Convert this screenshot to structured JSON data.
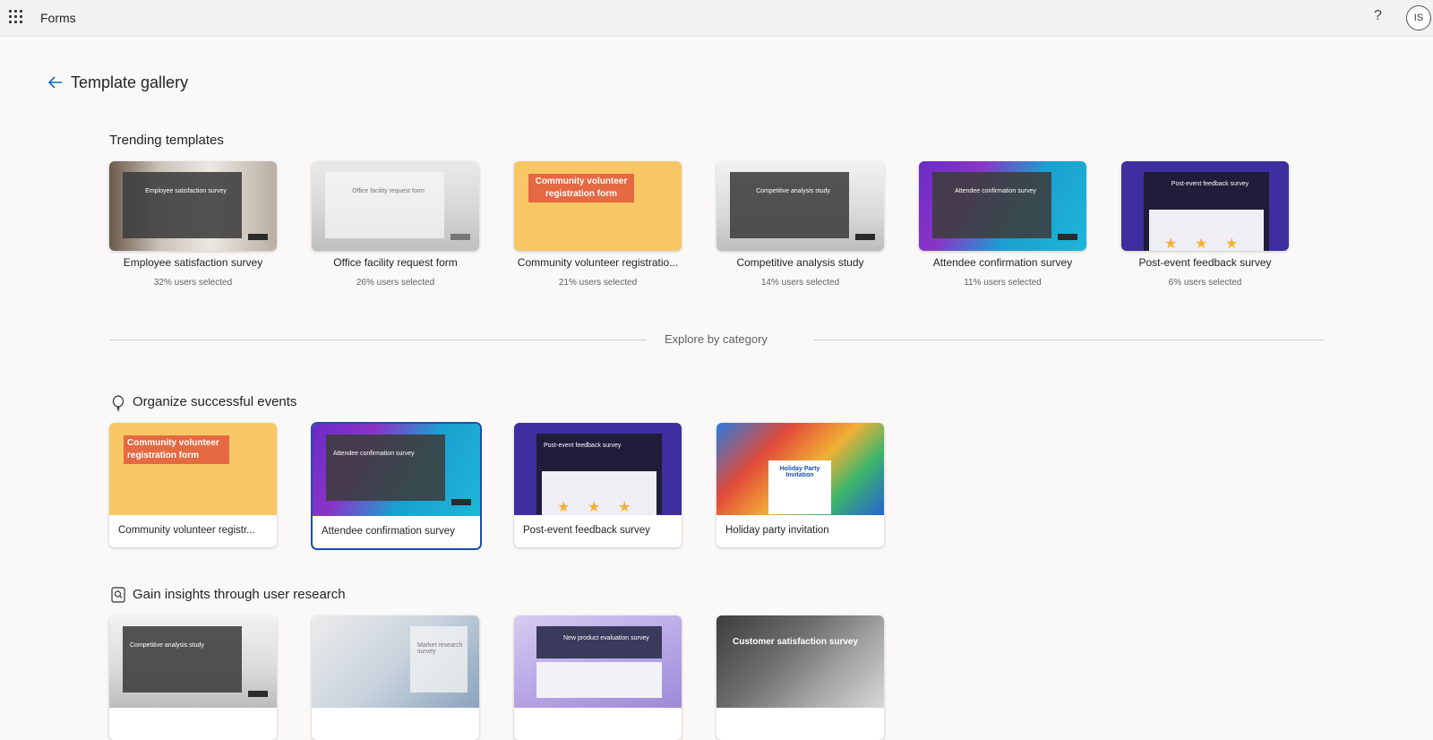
{
  "topbar": {
    "app_name": "Forms",
    "help": "?",
    "avatar": "IS"
  },
  "header": {
    "title": "Template gallery"
  },
  "trending": {
    "title": "Trending templates",
    "items": [
      {
        "name": "Employee satisfaction survey",
        "pct": "32% users selected",
        "thumb_title": "Employee satisfaction survey"
      },
      {
        "name": "Office facility request form",
        "pct": "26% users selected",
        "thumb_title": "Office facility request form"
      },
      {
        "name": "Community volunteer registration form",
        "display_name": "Community volunteer registratio...",
        "pct": "21% users selected",
        "thumb_title": "Community volunteer registration form"
      },
      {
        "name": "Competitive analysis study",
        "pct": "14% users selected",
        "thumb_title": "Competitive analysis study"
      },
      {
        "name": "Attendee confirmation survey",
        "pct": "11% users selected",
        "thumb_title": "Attendee confirmation survey"
      },
      {
        "name": "Post-event feedback survey",
        "pct": "6% users selected",
        "thumb_title": "Post-event feedback survey"
      }
    ]
  },
  "divider": {
    "label": "Explore by category"
  },
  "events": {
    "title": "Organize successful events",
    "icon": "balloon-icon",
    "items": [
      {
        "name": "Community volunteer registr...",
        "thumb_title": "Community volunteer registration form"
      },
      {
        "name": "Attendee confirmation survey",
        "thumb_title": "Attendee confirmation survey"
      },
      {
        "name": "Post-event feedback survey",
        "thumb_title": "Post-event feedback survey"
      },
      {
        "name": "Holiday party invitation",
        "thumb_title": "Holiday Party Invitation"
      }
    ]
  },
  "research": {
    "title": "Gain insights through user research",
    "icon": "research-icon",
    "items": [
      {
        "thumb_title": "Competitive analysis study"
      },
      {
        "thumb_title": "Market research survey"
      },
      {
        "thumb_title": "New product evaluation survey"
      },
      {
        "thumb_title": "Customer satisfaction survey"
      }
    ]
  },
  "colors": {
    "accent": "#1b4fa8",
    "background": "#faf9f8",
    "topbar": "#f3f2f1"
  }
}
